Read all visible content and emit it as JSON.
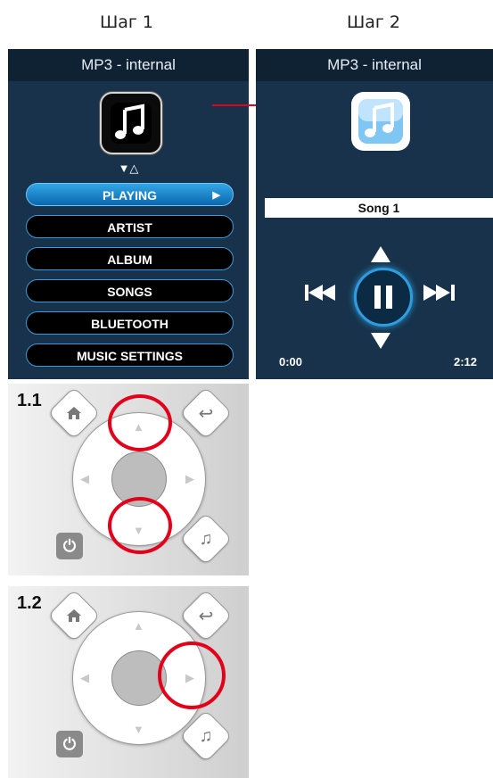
{
  "steps": {
    "step1": "Шаг 1",
    "step2": "Шаг 2"
  },
  "screen1": {
    "title": "MP3 - internal",
    "icon": "music-note-icon",
    "scroll_indicator": "▼△",
    "menu": [
      {
        "label": "PLAYING",
        "active": true
      },
      {
        "label": "ARTIST",
        "active": false
      },
      {
        "label": "ALBUM",
        "active": false
      },
      {
        "label": "SONGS",
        "active": false
      },
      {
        "label": "BLUETOOTH",
        "active": false
      },
      {
        "label": "MUSIC SETTINGS",
        "active": false
      }
    ]
  },
  "screen2": {
    "title": "MP3 - internal",
    "icon": "music-note-icon",
    "song": "Song 1",
    "elapsed": "0:00",
    "duration": "2:12"
  },
  "panels": [
    {
      "number": "1.1",
      "highlight": "up-and-down"
    },
    {
      "number": "1.2",
      "highlight": "right"
    }
  ],
  "colors": {
    "screen_bg": "#17324a",
    "title_bg": "#0f2233",
    "accent_blue": "#2e9de0",
    "highlight_red": "#e3001b",
    "arrow_red": "#e3001b"
  }
}
